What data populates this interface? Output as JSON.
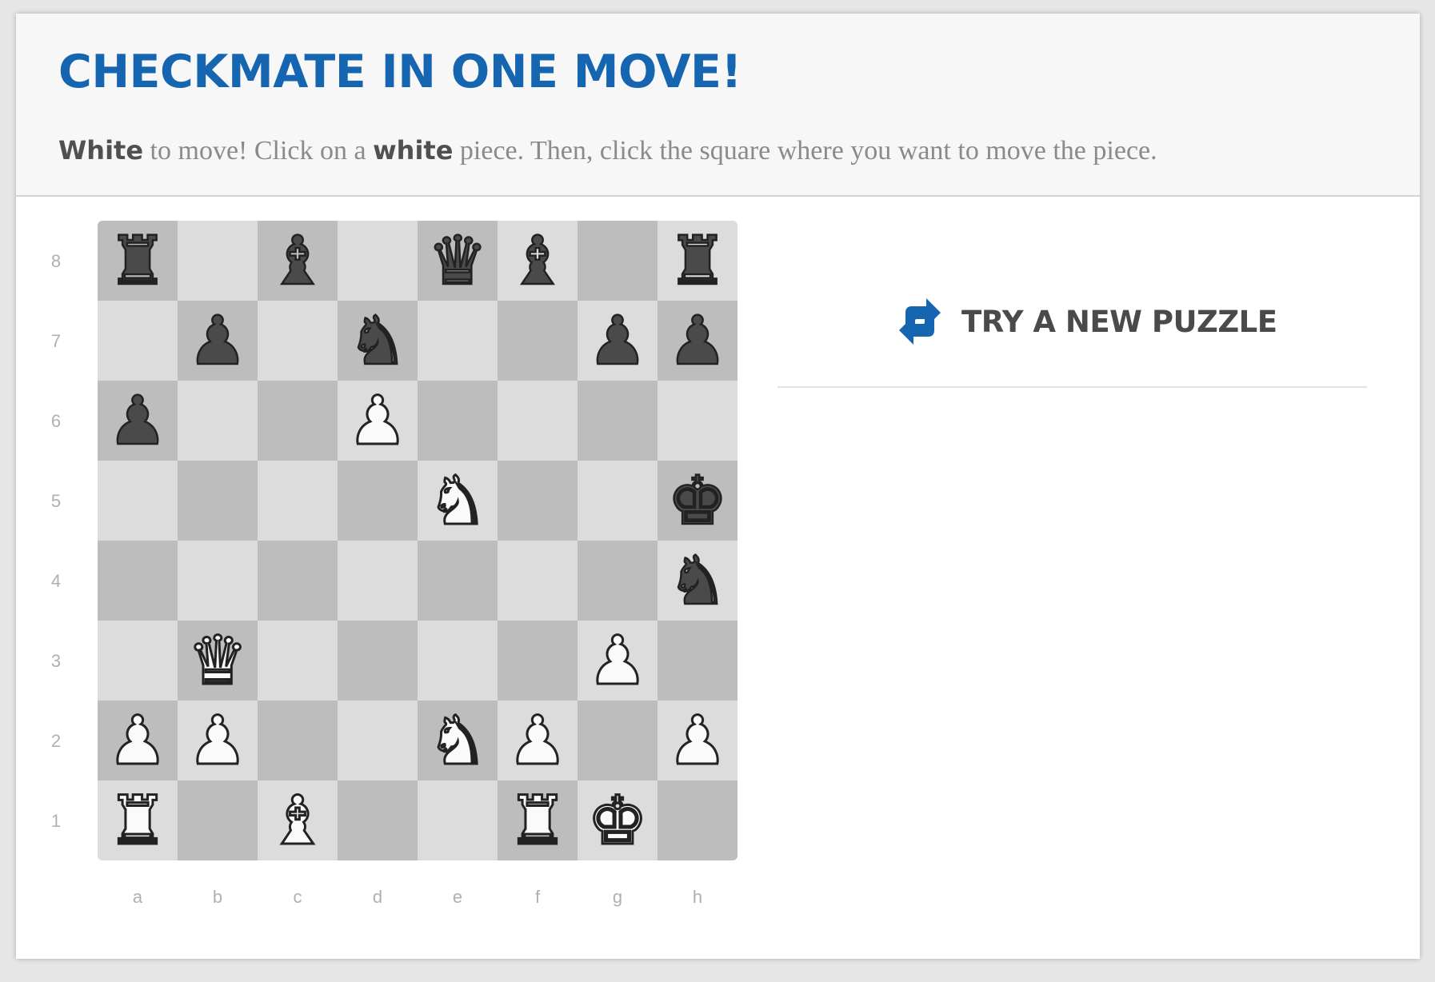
{
  "header": {
    "title": "CHECKMATE IN ONE MOVE!",
    "instructions": {
      "w1": "White",
      "t1": " to move! Click on a ",
      "w2": "white",
      "t2": " piece. Then, click the square where you want to move the piece."
    }
  },
  "board": {
    "files": [
      "a",
      "b",
      "c",
      "d",
      "e",
      "f",
      "g",
      "h"
    ],
    "ranks": [
      "8",
      "7",
      "6",
      "5",
      "4",
      "3",
      "2",
      "1"
    ],
    "rows": [
      [
        "r",
        "",
        "b",
        "",
        "q",
        "b",
        "",
        "r"
      ],
      [
        "",
        "p",
        "",
        "n",
        "",
        "",
        "p",
        "p"
      ],
      [
        "p",
        "",
        "",
        "P",
        "",
        "",
        "",
        ""
      ],
      [
        "",
        "",
        "",
        "",
        "N",
        "",
        "",
        "k"
      ],
      [
        "",
        "",
        "",
        "",
        "",
        "",
        "",
        "n"
      ],
      [
        "",
        "Q",
        "",
        "",
        "",
        "",
        "P",
        ""
      ],
      [
        "P",
        "P",
        "",
        "",
        "N",
        "P",
        "",
        "P"
      ],
      [
        "R",
        "",
        "B",
        "",
        "",
        "R",
        "K",
        ""
      ]
    ],
    "to_move": "white"
  },
  "sidebar": {
    "new_puzzle_label": "TRY A NEW PUZZLE",
    "icon": "refresh-icon"
  },
  "colors": {
    "title": "#1565b0",
    "light_square": "#dcdcdc",
    "dark_square": "#bdbdbd",
    "icon_blue": "#1565b0"
  }
}
